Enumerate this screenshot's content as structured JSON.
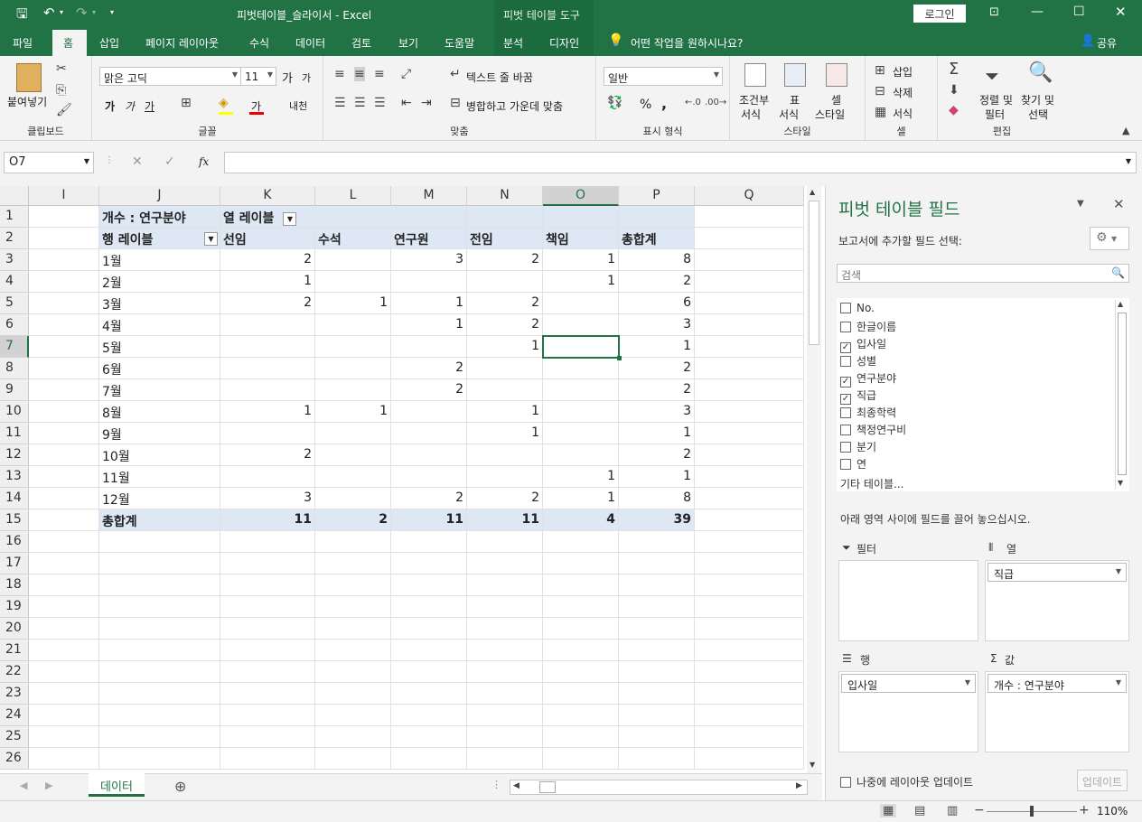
{
  "titlebar": {
    "doc_title": "피벗테이블_슬라이서  -  Excel",
    "context_tools": "피벗 테이블 도구",
    "login": "로그인",
    "icons": [
      "save-icon",
      "undo-icon",
      "redo-icon",
      "customize-icon",
      "ribbon-display-icon",
      "minimize-icon",
      "maximize-icon",
      "close-icon"
    ]
  },
  "tabs": [
    "파일",
    "홈",
    "삽입",
    "페이지 레이아웃",
    "수식",
    "데이터",
    "검토",
    "보기",
    "도움말",
    "분석",
    "디자인"
  ],
  "active_tab": "홈",
  "tell_me": "어떤 작업을 원하시나요?",
  "share": "공유",
  "ribbon": {
    "clipboard": {
      "paste": "붙여넣기",
      "label": "클립보드"
    },
    "font": {
      "name": "맑은 고딕",
      "size": "11",
      "grow": "가",
      "shrink": "가",
      "bold": "가",
      "italic": "가",
      "underline": "가",
      "fontcolor": "가",
      "phonetic": "내천",
      "label": "글꼴"
    },
    "align": {
      "wrap": "텍스트 줄 바꿈",
      "merge": "병합하고 가운데 맞춤",
      "label": "맞춤"
    },
    "number": {
      "format": "일반",
      "percent": "%",
      "comma": ",",
      "label": "표시 형식"
    },
    "styles": {
      "cond": "조건부\n서식",
      "cond1": "조건부",
      "cond2": "서식",
      "table1": "표",
      "table2": "서식",
      "cell1": "셀",
      "cell2": "스타일",
      "label": "스타일"
    },
    "cells": {
      "insert": "삽입",
      "delete": "삭제",
      "format": "서식",
      "label": "셀"
    },
    "edit": {
      "sort1": "정렬 및",
      "sort2": "필터",
      "find1": "찾기 및",
      "find2": "선택",
      "label": "편집"
    }
  },
  "formula_bar": {
    "name_box": "O7",
    "fx": "fx",
    "formula": ""
  },
  "columns": [
    "I",
    "J",
    "K",
    "L",
    "M",
    "N",
    "O",
    "P",
    "Q"
  ],
  "selected_column": "O",
  "selected_row": 7,
  "rows": [
    1,
    2,
    3,
    4,
    5,
    6,
    7,
    8,
    9,
    10,
    11,
    12,
    13,
    14,
    15,
    16,
    17,
    18,
    19,
    20,
    21,
    22,
    23,
    24,
    25,
    26
  ],
  "pivot": {
    "corner": "개수 : 연구분야",
    "col_label": "열 레이블",
    "row_label": "행 레이블",
    "col_headers": [
      "선임",
      "수석",
      "연구원",
      "전임",
      "책임",
      "총합계"
    ],
    "rows": [
      {
        "label": "1월",
        "values": [
          "2",
          "",
          "3",
          "2",
          "1",
          "8"
        ]
      },
      {
        "label": "2월",
        "values": [
          "1",
          "",
          "",
          "",
          "1",
          "2"
        ]
      },
      {
        "label": "3월",
        "values": [
          "2",
          "1",
          "1",
          "2",
          "",
          "6"
        ]
      },
      {
        "label": "4월",
        "values": [
          "",
          "",
          "1",
          "2",
          "",
          "3"
        ]
      },
      {
        "label": "5월",
        "values": [
          "",
          "",
          "",
          "1",
          "",
          "1"
        ]
      },
      {
        "label": "6월",
        "values": [
          "",
          "",
          "2",
          "",
          "",
          "2"
        ]
      },
      {
        "label": "7월",
        "values": [
          "",
          "",
          "2",
          "",
          "",
          "2"
        ]
      },
      {
        "label": "8월",
        "values": [
          "1",
          "1",
          "",
          "1",
          "",
          "3"
        ]
      },
      {
        "label": "9월",
        "values": [
          "",
          "",
          "",
          "1",
          "",
          "1"
        ]
      },
      {
        "label": "10월",
        "values": [
          "2",
          "",
          "",
          "",
          "",
          "2"
        ]
      },
      {
        "label": "11월",
        "values": [
          "",
          "",
          "",
          "",
          "1",
          "1"
        ]
      },
      {
        "label": "12월",
        "values": [
          "3",
          "",
          "2",
          "2",
          "1",
          "8"
        ]
      }
    ],
    "total": {
      "label": "총합계",
      "values": [
        "11",
        "2",
        "11",
        "11",
        "4",
        "39"
      ]
    }
  },
  "sheet_tab": "데이터",
  "panel": {
    "title": "피벗 테이블 필드",
    "subtitle": "보고서에 추가할 필드 선택:",
    "search_placeholder": "검색",
    "fields": [
      {
        "name": "No.",
        "checked": false
      },
      {
        "name": "한글이름",
        "checked": false
      },
      {
        "name": "입사일",
        "checked": true
      },
      {
        "name": "성별",
        "checked": false
      },
      {
        "name": "연구분야",
        "checked": true
      },
      {
        "name": "직급",
        "checked": true
      },
      {
        "name": "최종학력",
        "checked": false
      },
      {
        "name": "책정연구비",
        "checked": false
      },
      {
        "name": "분기",
        "checked": false
      },
      {
        "name": "연",
        "checked": false
      }
    ],
    "more_tables": "기타 테이블...",
    "drag_hint": "아래 영역 사이에 필드를 끌어 놓으십시오.",
    "zones": {
      "filter": {
        "label": "필터",
        "items": []
      },
      "columns": {
        "label": "열",
        "items": [
          "직급"
        ]
      },
      "rows": {
        "label": "행",
        "items": [
          "입사일"
        ]
      },
      "values": {
        "label": "값",
        "items": [
          "개수 : 연구분야"
        ]
      }
    },
    "defer": "나중에 레이아웃 업데이트",
    "update": "업데이트"
  },
  "status": {
    "zoom": "110%"
  },
  "colors": {
    "accent": "#217346",
    "pivot_header": "#dde8f4"
  }
}
